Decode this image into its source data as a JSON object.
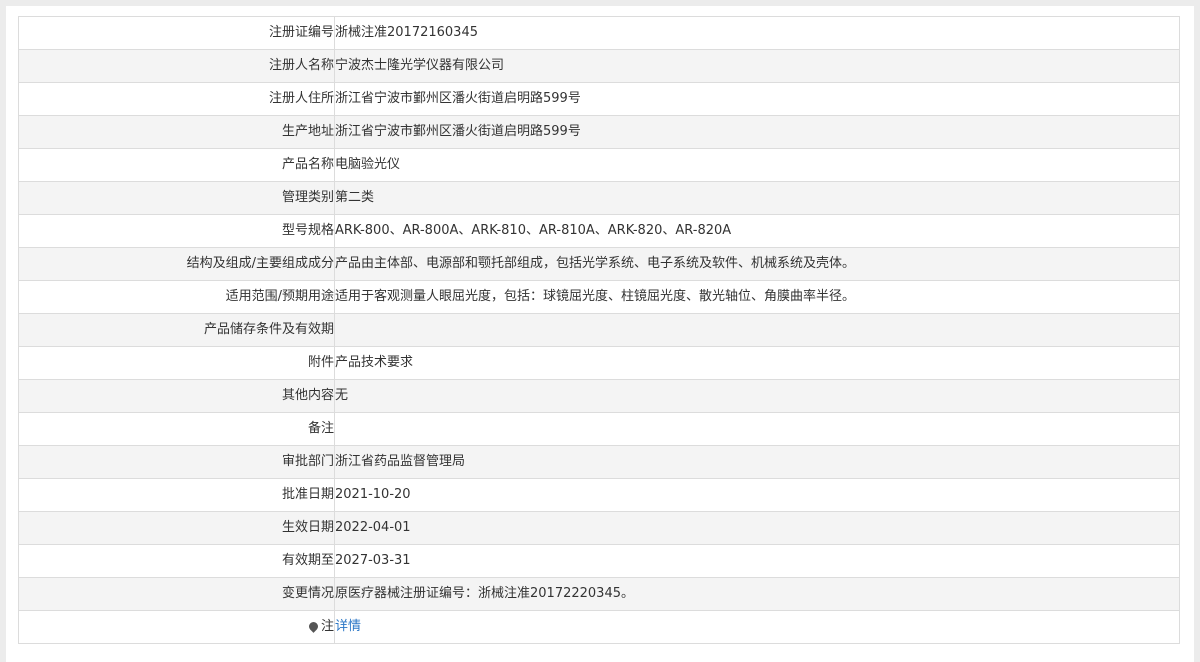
{
  "rows": [
    {
      "label": "注册证编号",
      "value": "浙械注准20172160345"
    },
    {
      "label": "注册人名称",
      "value": "宁波杰士隆光学仪器有限公司"
    },
    {
      "label": "注册人住所",
      "value": "浙江省宁波市鄞州区潘火街道启明路599号"
    },
    {
      "label": "生产地址",
      "value": "浙江省宁波市鄞州区潘火街道启明路599号"
    },
    {
      "label": "产品名称",
      "value": "电脑验光仪"
    },
    {
      "label": "管理类别",
      "value": "第二类"
    },
    {
      "label": "型号规格",
      "value": "ARK-800、AR-800A、ARK-810、AR-810A、ARK-820、AR-820A"
    },
    {
      "label": "结构及组成/主要组成成分",
      "value": "产品由主体部、电源部和颚托部组成，包括光学系统、电子系统及软件、机械系统及壳体。"
    },
    {
      "label": "适用范围/预期用途",
      "value": "适用于客观测量人眼屈光度，包括：球镜屈光度、柱镜屈光度、散光轴位、角膜曲率半径。"
    },
    {
      "label": "产品储存条件及有效期",
      "value": ""
    },
    {
      "label": "附件",
      "value": "产品技术要求"
    },
    {
      "label": "其他内容",
      "value": "无"
    },
    {
      "label": "备注",
      "value": ""
    },
    {
      "label": "审批部门",
      "value": "浙江省药品监督管理局"
    },
    {
      "label": "批准日期",
      "value": "2021-10-20"
    },
    {
      "label": "生效日期",
      "value": "2022-04-01"
    },
    {
      "label": "有效期至",
      "value": "2027-03-31"
    },
    {
      "label": "变更情况",
      "value": "原医疗器械注册证编号：浙械注准20172220345。"
    }
  ],
  "note_row": {
    "label": "注",
    "icon": "map-pin-icon",
    "link_text": "详情"
  }
}
